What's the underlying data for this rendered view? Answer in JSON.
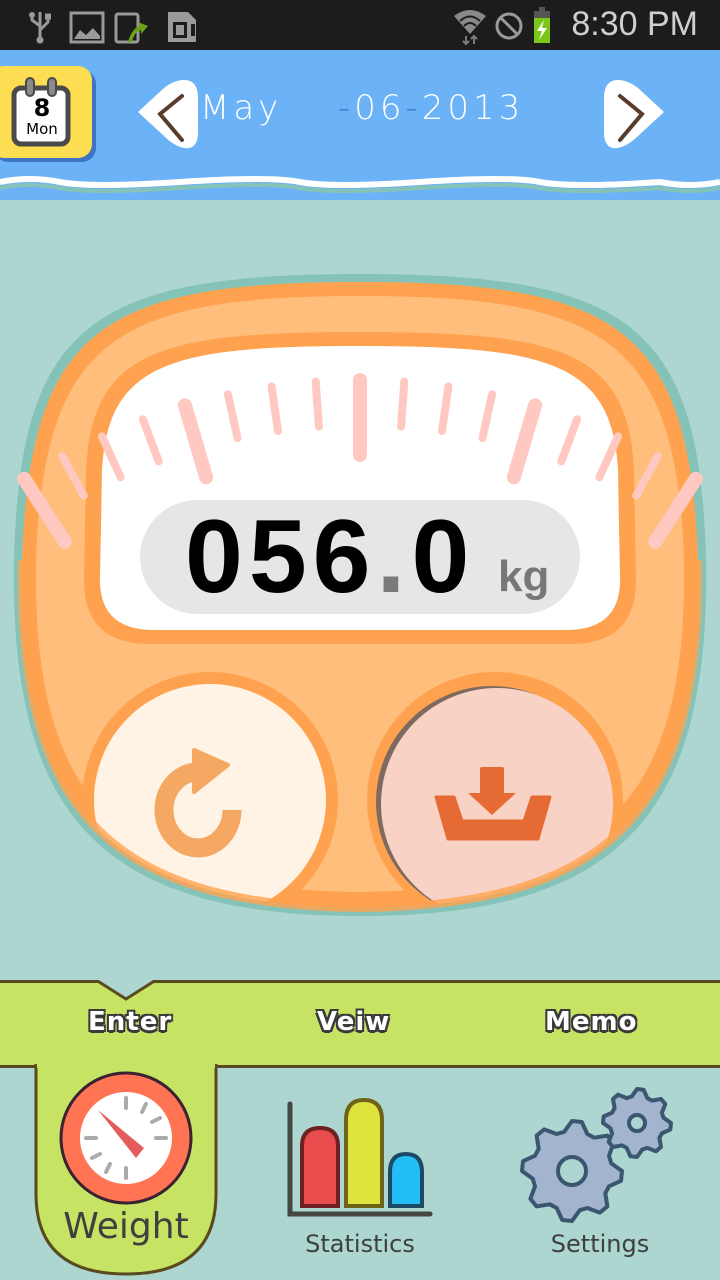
{
  "status_bar": {
    "time": "8:30 PM",
    "left_icons": [
      "usb-icon",
      "image-icon",
      "phone-upload-icon",
      "sd-card-icon"
    ],
    "right_icons": [
      "wifi-icon",
      "no-sign-icon",
      "battery-charging-icon"
    ],
    "battery_color": "#7bc618"
  },
  "header": {
    "calendar": {
      "day": "8",
      "weekday": "Mon"
    },
    "date": {
      "month": "May",
      "day": "06",
      "year": "2013",
      "separator": "-"
    },
    "prev_icon": "chevron-left-icon",
    "next_icon": "chevron-right-icon",
    "bg_color": "#6cb2f6"
  },
  "scale": {
    "value_integer": "056",
    "value_decimal_point": ".",
    "value_fraction": "0",
    "unit": "kg",
    "reset_icon": "redo-icon",
    "save_icon": "download-tray-icon"
  },
  "tabs": [
    {
      "label": "Enter",
      "active": true
    },
    {
      "label": "Veiw",
      "active": false
    },
    {
      "label": "Memo",
      "active": false
    }
  ],
  "bottom_nav": [
    {
      "label": "Weight",
      "icon": "gauge-icon",
      "active": true
    },
    {
      "label": "Statistics",
      "icon": "bar-chart-icon",
      "active": false
    },
    {
      "label": "Settings",
      "icon": "gears-icon",
      "active": false
    }
  ]
}
